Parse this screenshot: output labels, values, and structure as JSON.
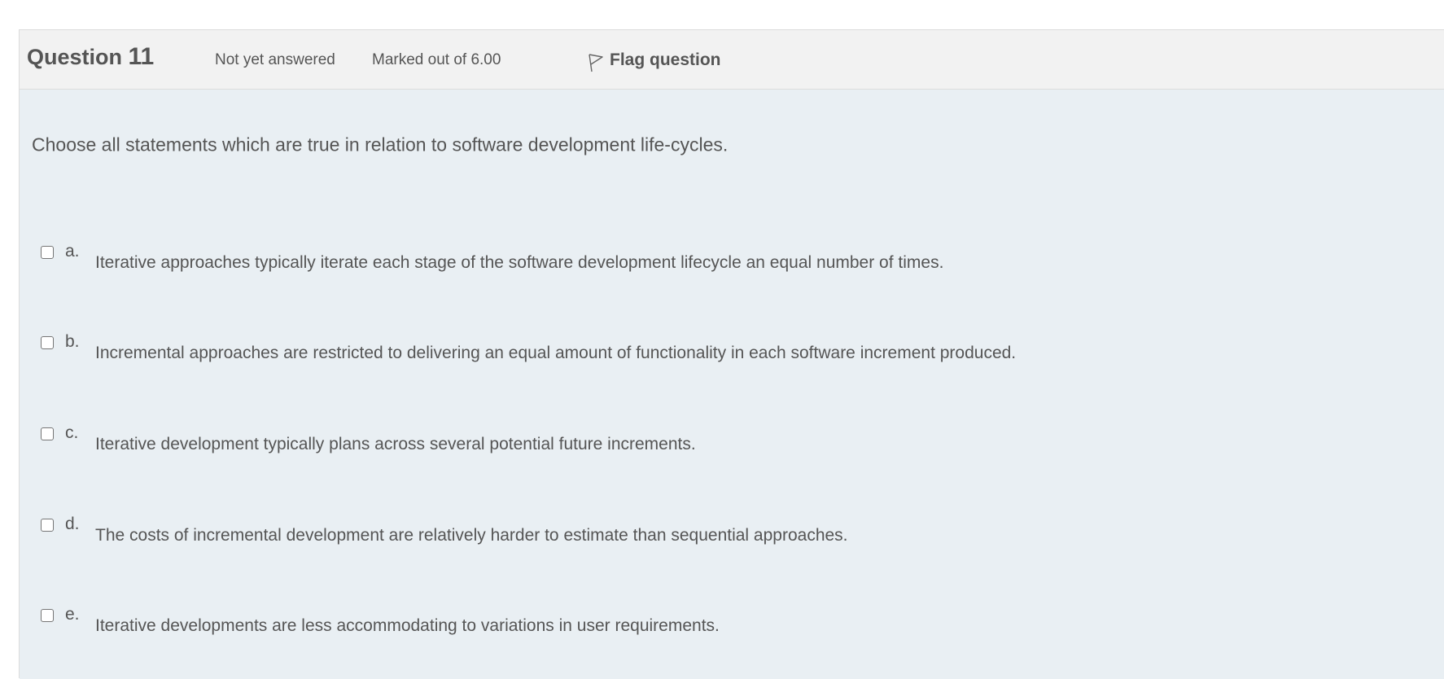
{
  "question": {
    "title_prefix": "Question",
    "number": "11",
    "status": "Not yet answered",
    "marks": "Marked out of 6.00",
    "flag_label": "Flag question",
    "text": "Choose all statements which are true in relation to software development life-cycles."
  },
  "options": [
    {
      "letter": "a.",
      "text": "Iterative approaches typically iterate each stage of the software development lifecycle an equal number of times.",
      "checked": false
    },
    {
      "letter": "b.",
      "text": "Incremental approaches are restricted to delivering an equal amount of functionality in each software increment produced.",
      "checked": false
    },
    {
      "letter": "c.",
      "text": "Iterative development typically plans across several potential future increments.",
      "checked": false
    },
    {
      "letter": "d.",
      "text": "The costs of incremental development are relatively harder to estimate than sequential approaches.",
      "checked": false
    },
    {
      "letter": "e.",
      "text": "Iterative developments are less accommodating to variations in user requirements.",
      "checked": false
    }
  ],
  "colors": {
    "header_bg": "#f2f2f2",
    "body_bg": "#e9eff3",
    "text": "#555555"
  },
  "icons": {
    "flag": "flag-icon",
    "checkbox": "checkbox-unchecked"
  }
}
